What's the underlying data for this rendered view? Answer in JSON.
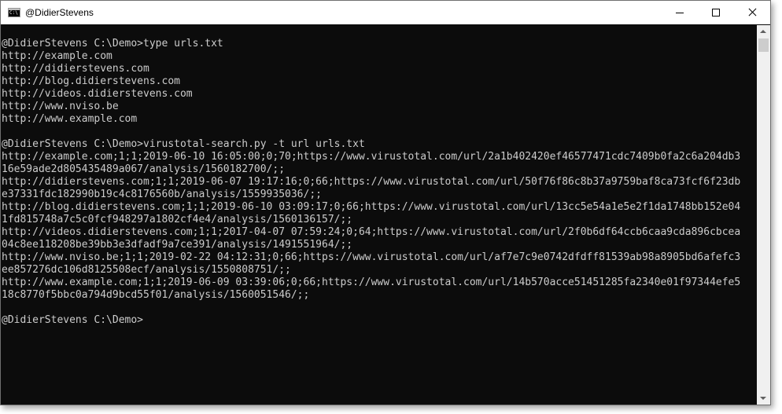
{
  "window": {
    "title": "@DidierStevens",
    "icon": "command-prompt-icon",
    "icon_text": "C:\\",
    "controls": [
      "minimize-icon",
      "maximize-icon",
      "close-icon"
    ]
  },
  "console": {
    "lines": [
      "@DidierStevens C:\\Demo>type urls.txt",
      "http://example.com",
      "http://didierstevens.com",
      "http://blog.didierstevens.com",
      "http://videos.didierstevens.com",
      "http://www.nviso.be",
      "http://www.example.com",
      "",
      "@DidierStevens C:\\Demo>virustotal-search.py -t url urls.txt",
      "http://example.com;1;1;2019-06-10 16:05:00;0;70;https://www.virustotal.com/url/2a1b402420ef46577471cdc7409b0fa2c6a204db3",
      "16e59ade2d805435489a067/analysis/1560182700/;;",
      "http://didierstevens.com;1;1;2019-06-07 19:17:16;0;66;https://www.virustotal.com/url/50f76f86c8b37a9759baf8ca73fcf6f23db",
      "e37331fdc182990b19c4c8176560b/analysis/1559935036/;;",
      "http://blog.didierstevens.com;1;1;2019-06-10 03:09:17;0;66;https://www.virustotal.com/url/13cc5e54a1e5e2f1da1748bb152e04",
      "1fd815748a7c5c0fcf948297a1802cf4e4/analysis/1560136157/;;",
      "http://videos.didierstevens.com;1;1;2017-04-07 07:59:24;0;64;https://www.virustotal.com/url/2f0b6df64ccb6caa9cda896cbcea",
      "04c8ee118208be39bb3e3dfadf9a7ce391/analysis/1491551964/;;",
      "http://www.nviso.be;1;1;2019-02-22 04:12:31;0;66;https://www.virustotal.com/url/af7e7c9e0742dfdff81539ab98a8905bd6afefc3",
      "ee857276dc106d8125508ecf/analysis/1550808751/;;",
      "http://www.example.com;1;1;2019-06-09 03:39:06;0;66;https://www.virustotal.com/url/14b570acce51451285fa2340e01f97344efe5",
      "18c8770f5bbc0a794d9bcd55f01/analysis/1560051546/;;",
      "",
      "@DidierStevens C:\\Demo>"
    ],
    "text_color": "#cccccc",
    "background": "#0c0c0c"
  }
}
